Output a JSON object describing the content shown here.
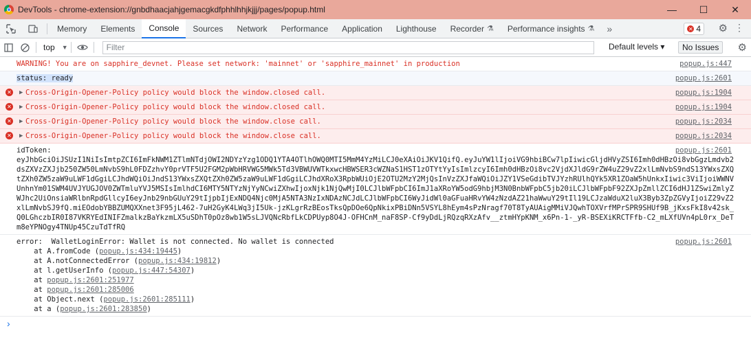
{
  "window": {
    "title": "DevTools - chrome-extension://gnbdhaacjahjgemacgkdfphhlhhjkjjj/pages/popup.html",
    "minimize": "—",
    "maximize": "☐",
    "close": "✕"
  },
  "tabs": {
    "items": [
      {
        "label": "Memory"
      },
      {
        "label": "Elements"
      },
      {
        "label": "Console"
      },
      {
        "label": "Sources"
      },
      {
        "label": "Network"
      },
      {
        "label": "Performance"
      },
      {
        "label": "Application"
      },
      {
        "label": "Lighthouse"
      },
      {
        "label": "Recorder"
      },
      {
        "label": "Performance insights"
      }
    ],
    "more": "»",
    "error_count": "4"
  },
  "toolbar": {
    "context": "top",
    "filter_placeholder": "Filter",
    "levels": "Default levels ▾",
    "issues": "No Issues"
  },
  "messages": {
    "warning": {
      "text": "WARNING! You are on sapphire_devnet. Please set network: 'mainnet' or 'sapphire_mainnet' in production",
      "src": "popup.js:447"
    },
    "status": {
      "text": "status:  ready",
      "src": "popup.js:2601"
    },
    "errors": [
      {
        "text": "Cross-Origin-Opener-Policy policy would block the window.closed call.",
        "src": "popup.js:1904"
      },
      {
        "text": "Cross-Origin-Opener-Policy policy would block the window.closed call.",
        "src": "popup.js:1904"
      },
      {
        "text": "Cross-Origin-Opener-Policy policy would block the window.close call.",
        "src": "popup.js:2034"
      },
      {
        "text": "Cross-Origin-Opener-Policy policy would block the window.close call.",
        "src": "popup.js:2034"
      }
    ],
    "idtoken": {
      "label": "idToken:",
      "value": "eyJhbGciOiJSUzI1NiIsImtpZCI6ImFkNWM1ZTlmNTdjOWI2NDYzYzg1ODQ1YTA4OTlhOWQ0MTI5MmM4YzMiLCJ0eXAiOiJKV1QifQ.eyJuYW1lIjoiVG9hbiBCw7lpIiwicGljdHVyZSI6Imh0dHBzOi8vbGgzLmdvb2dsZXVzZXJjb250ZW50LmNvbS9hL0FDZzhvY0prVTF5U2FGM2pWbHRVWG5MWk5Td3VBWUVWTkxwcHBWSER3cWZNaS1HST1zOTYtYyIsImlzcyI6Imh0dHBzOi8vc2VjdXJldG9rZW4uZ29vZ2xlLmNvbS9ndS13YWxsZXQtZXh0ZW5zaW9uLWF1dGgiLCJhdWQiOiJndS13YWxsZXQtZXh0ZW5zaW9uLWF1dGgiLCJhdXRoX3RpbWUiOjE2OTU2MzY2MjQsInVzZXJfaWQiOiJZY1VSeGdibTVJYzhRUlhQYk5XR1ZOaW5hUnkxIiwic3ViIjoiWWNVUnhnYm01SWM4UVJYUGJOV0ZWTmluYVJ5MSIsImlhdCI6MTY5NTYzNjYyNCwiZXhwIjoxNjk1NjQwMjI0LCJlbWFpbCI6ImJ1aXRoYW5odG9hbjM3N0BnbWFpbC5jb20iLCJlbWFpbF92ZXJpZmllZCI6dHJ1ZSwiZmlyZWJhc2UiOnsiaWRlbnRpdGllcyI6eyJnb29nbGUuY29tIjpbIjExNDQ4Njc0MjA5NTA3NzIxNDAzNCJdLCJlbWFpbCI6WyJidWl0aGFuaHRvYW4zNzdAZ21haWwuY29tIl19LCJzaWduX2luX3Byb3ZpZGVyIjoiZ29vZ2xlLmNvbSJ9fQ.miEOdobYBBZUMQXXnet3F95jL462-7uH2GyK4LWq3jI5Uk-jzKLgrRzBEosTksQpDOe6QpNkixPBiDNn5VSYL8hEym4sPzNragf70T8TyAUAigMMiVJQwhTOXVrfMPrSPR9SHUf9B_jKxsFkI8v42sk_Q0LGhczbIR0I87VKRYEdINIFZmalkzBaYkzmLX5uSDhT0pOz8wb1W5sLJVQNcRbfLkCDPUyp8O4J-OFHCnM_naF8SP-Cf9yDdLjRQzqRXzAfv__ztmHYpKNM_x6Pn-1-_yR-BSEXiKRCTFfb-C2_mLXfUVn4pL0rx_DeTm8eYPNOgy4TNUp45CzuTdTfRQ",
      "src": "popup.js:2601"
    },
    "walleterror": {
      "text": "error:  WalletLoginError: Wallet is not connected. No wallet is connected",
      "src": "popup.js:2601",
      "stack": [
        {
          "prefix": "    at A.fromCode (",
          "link": "popup.js:434:19445",
          "suffix": ")"
        },
        {
          "prefix": "    at A.notConnectedError (",
          "link": "popup.js:434:19812",
          "suffix": ")"
        },
        {
          "prefix": "    at l.getUserInfo (",
          "link": "popup.js:447:54307",
          "suffix": ")"
        },
        {
          "prefix": "    at ",
          "link": "popup.js:2601:251977",
          "suffix": ""
        },
        {
          "prefix": "    at ",
          "link": "popup.js:2601:285006",
          "suffix": ""
        },
        {
          "prefix": "    at Object.next (",
          "link": "popup.js:2601:285111",
          "suffix": ")"
        },
        {
          "prefix": "    at a (",
          "link": "popup.js:2601:283850",
          "suffix": ")"
        }
      ]
    },
    "prompt": "›"
  }
}
